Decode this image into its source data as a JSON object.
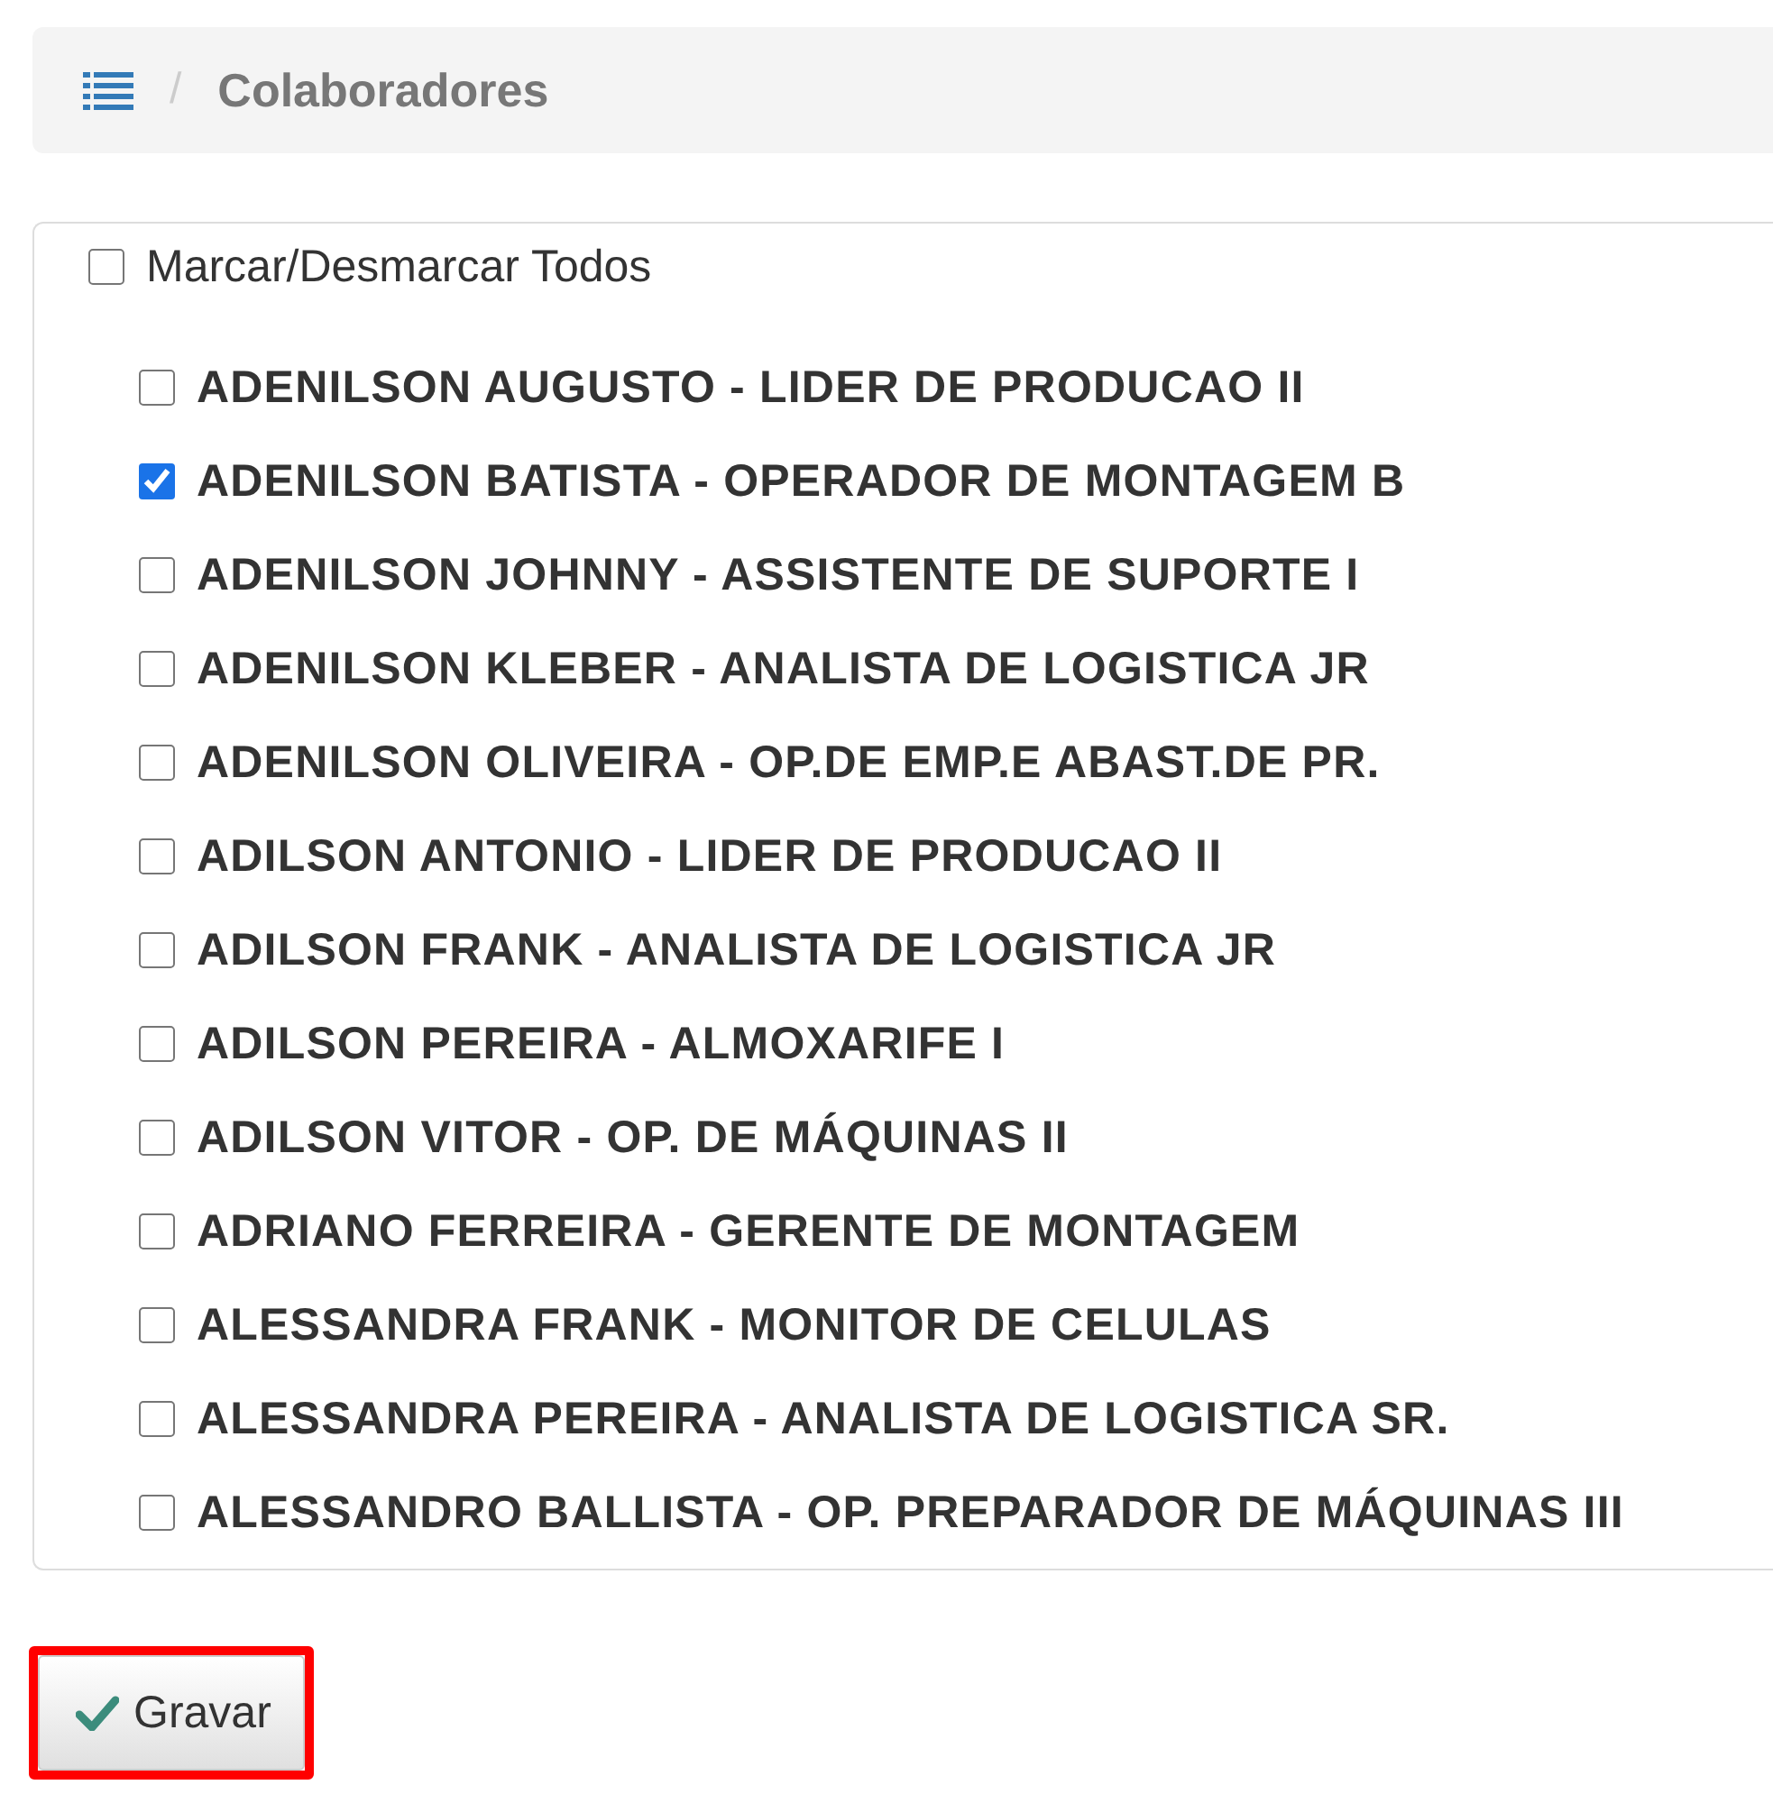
{
  "breadcrumb": {
    "title": "Colaboradores",
    "separator": "/"
  },
  "select_all": {
    "label": "Marcar/Desmarcar Todos",
    "checked": false
  },
  "employees": [
    {
      "label": "ADENILSON AUGUSTO - LIDER DE PRODUCAO II",
      "checked": false
    },
    {
      "label": "ADENILSON BATISTA - OPERADOR DE MONTAGEM B",
      "checked": true
    },
    {
      "label": "ADENILSON JOHNNY - ASSISTENTE DE SUPORTE I",
      "checked": false
    },
    {
      "label": "ADENILSON KLEBER - ANALISTA DE LOGISTICA JR",
      "checked": false
    },
    {
      "label": "ADENILSON OLIVEIRA - OP.DE EMP.E ABAST.DE PR.",
      "checked": false
    },
    {
      "label": "ADILSON ANTONIO - LIDER DE PRODUCAO II",
      "checked": false
    },
    {
      "label": "ADILSON FRANK - ANALISTA DE LOGISTICA JR",
      "checked": false
    },
    {
      "label": "ADILSON PEREIRA - ALMOXARIFE I",
      "checked": false
    },
    {
      "label": "ADILSON VITOR - OP. DE MÁQUINAS II",
      "checked": false
    },
    {
      "label": "ADRIANO FERREIRA - GERENTE DE MONTAGEM",
      "checked": false
    },
    {
      "label": "ALESSANDRA FRANK - MONITOR DE CELULAS",
      "checked": false
    },
    {
      "label": "ALESSANDRA PEREIRA - ANALISTA DE LOGISTICA SR.",
      "checked": false
    },
    {
      "label": "ALESSANDRO BALLISTA - OP. PREPARADOR DE MÁQUINAS III",
      "checked": false
    }
  ],
  "save_button": {
    "label": "Gravar",
    "highlighted": true
  }
}
